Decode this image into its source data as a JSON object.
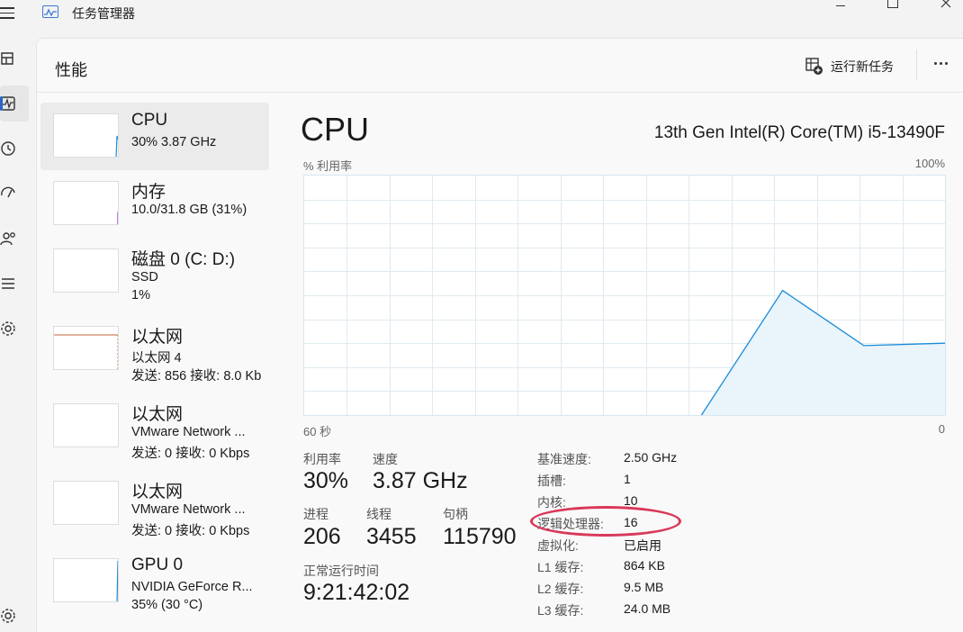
{
  "window": {
    "title": "任务管理器"
  },
  "header": {
    "page_title": "性能",
    "run_new_task": "运行新任务"
  },
  "rail": {
    "icons": [
      "menu-icon",
      "processes-icon",
      "performance-icon",
      "app-history-icon",
      "startup-apps-icon",
      "users-icon",
      "details-icon",
      "services-icon",
      "settings-icon"
    ],
    "active": "performance-icon"
  },
  "sidebar": {
    "items": [
      {
        "title": "CPU",
        "line1": "30% 3.87 GHz",
        "line2": "",
        "color": "#1a8cd8"
      },
      {
        "title": "内存",
        "line1": "10.0/31.8 GB (31%)",
        "line2": "",
        "color": "#a23cc8"
      },
      {
        "title": "磁盘 0 (C: D:)",
        "line1": "SSD",
        "line2": "1%",
        "color": "#4a9a3a"
      },
      {
        "title": "以太网",
        "line1": "以太网 4",
        "line2": "发送: 856 接收: 8.0 Kb",
        "color": "#c0653a"
      },
      {
        "title": "以太网",
        "line1": "VMware Network ...",
        "line2": "发送: 0 接收: 0 Kbps",
        "color": "#c0653a"
      },
      {
        "title": "以太网",
        "line1": "VMware Network ...",
        "line2": "发送: 0 接收: 0 Kbps",
        "color": "#c0653a"
      },
      {
        "title": "GPU 0",
        "line1": "NVIDIA GeForce R...",
        "line2": "35% (30 °C)",
        "color": "#1a8cd8"
      }
    ]
  },
  "detail": {
    "title": "CPU",
    "model": "13th Gen Intel(R) Core(TM) i5-13490F",
    "y_label": "% 利用率",
    "y_max": "100%",
    "x_left": "60 秒",
    "x_right": "0",
    "stats": {
      "utilization_label": "利用率",
      "utilization_value": "30%",
      "speed_label": "速度",
      "speed_value": "3.87 GHz",
      "processes_label": "进程",
      "processes_value": "206",
      "threads_label": "线程",
      "threads_value": "3455",
      "handles_label": "句柄",
      "handles_value": "115790",
      "uptime_label": "正常运行时间",
      "uptime_value": "9:21:42:02"
    },
    "specs": [
      {
        "key": "基准速度:",
        "value": "2.50 GHz"
      },
      {
        "key": "插槽:",
        "value": "1"
      },
      {
        "key": "内核:",
        "value": "10"
      },
      {
        "key": "逻辑处理器:",
        "value": "16"
      },
      {
        "key": "虚拟化:",
        "value": "已启用"
      },
      {
        "key": "L1 缓存:",
        "value": "864 KB"
      },
      {
        "key": "L2 缓存:",
        "value": "9.5 MB"
      },
      {
        "key": "L3 缓存:",
        "value": "24.0 MB"
      }
    ],
    "annotation_color": "#d9385a"
  },
  "chart_data": {
    "type": "line",
    "title": "CPU",
    "ylabel": "% 利用率",
    "xlabel": "",
    "x_range_labels": [
      "60 秒",
      "0"
    ],
    "ylim": [
      0,
      100
    ],
    "grid": true,
    "series": [
      {
        "values_recent_seconds": [
          {
            "x": 3,
            "y": 0
          },
          {
            "x": 2,
            "y": 52
          },
          {
            "x": 1,
            "y": 29
          },
          {
            "x": 0,
            "y": 30
          }
        ]
      }
    ]
  },
  "colors": {
    "accent": "#2c64c8",
    "cpu_line": "#1a8cd8",
    "cpu_fill": "#eaf4fb",
    "grid": "#e0eaf0"
  }
}
